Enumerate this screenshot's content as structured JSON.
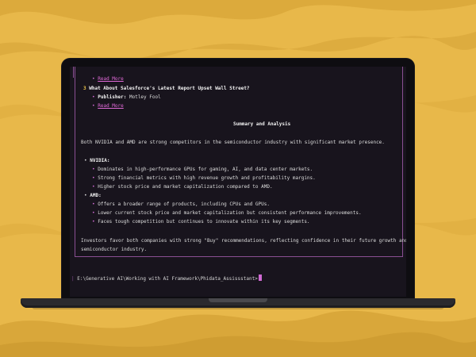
{
  "colors": {
    "background": "#e8b84a",
    "terminal_bg": "#18141d",
    "border": "#8a4f93",
    "accent": "#d06ad3",
    "number": "#e6c04a"
  },
  "terminal": {
    "top_link": "Read More",
    "item3": {
      "number": "3",
      "title": "What About Salesforce's Latest Report Upset Wall Street?",
      "publisher_label": "Publisher:",
      "publisher_value": "Motley Fool",
      "link": "Read More"
    },
    "summary_heading": "Summary and Analysis",
    "intro": "Both NVIDIA and AMD are strong competitors in the semiconductor industry with significant market presence.",
    "nvidia_label": "NVIDIA:",
    "nvidia_points": [
      "Dominates in high-performance GPUs for gaming, AI, and data center markets.",
      "Strong financial metrics with high revenue growth and profitability margins.",
      "Higher stock price and market capitalization compared to AMD."
    ],
    "amd_label": "AMD:",
    "amd_points": [
      "Offers a broader range of products, including CPUs and GPUs.",
      "Lower current stock price and market capitalization but consistent performance improvements.",
      "Faces tough competition but continues to innovate within its key segments."
    ],
    "conclusion_line1": "Investors favor both companies with strong \"Buy\" recommendations, reflecting confidence in their future growth and innovat",
    "conclusion_line2": "semiconductor industry.",
    "prompt_path": "E:\\Generative AI\\Working with AI Framework\\Phidata_Assissstant>"
  }
}
